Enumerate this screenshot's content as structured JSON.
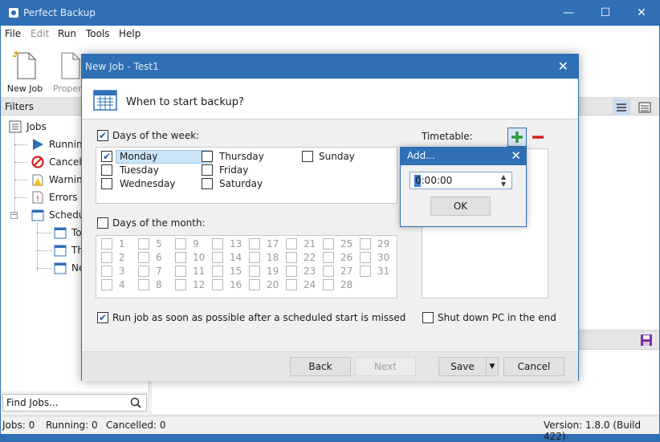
{
  "app": {
    "title": "Perfect Backup"
  },
  "window_controls": {
    "minimize": "—",
    "maximize": "☐",
    "close": "✕"
  },
  "menu": [
    "File",
    "Edit",
    "Run",
    "Tools",
    "Help"
  ],
  "toolbar": {
    "new_job": "New Job",
    "properties": "Propert"
  },
  "filters": {
    "header": "Filters",
    "tree": {
      "jobs": "Jobs",
      "running": "Running",
      "cancelled": "Cancelle",
      "warnings": "Warning",
      "errors": "Errors",
      "scheduled": "Schedul",
      "sub1": "To",
      "sub2": "Th",
      "sub3": "Ne"
    }
  },
  "find_jobs": {
    "placeholder": "Find Jobs..."
  },
  "status": {
    "jobs": "Jobs: 0",
    "running": "Running: 0",
    "cancelled": "Cancelled: 0",
    "version": "Version: 1.8.0 (Build 422)"
  },
  "dialog": {
    "title": "New Job - Test1",
    "heading": "When to start backup?",
    "days_of_week": {
      "label": "Days of the week:",
      "checked": true,
      "days": [
        {
          "name": "Monday",
          "checked": true,
          "selected": true
        },
        {
          "name": "Tuesday",
          "checked": false
        },
        {
          "name": "Wednesday",
          "checked": false
        },
        {
          "name": "Thursday",
          "checked": false
        },
        {
          "name": "Friday",
          "checked": false
        },
        {
          "name": "Saturday",
          "checked": false
        },
        {
          "name": "Sunday",
          "checked": false
        }
      ]
    },
    "days_of_month": {
      "label": "Days of the month:",
      "checked": false,
      "days": [
        "1",
        "2",
        "3",
        "4",
        "5",
        "6",
        "7",
        "8",
        "9",
        "10",
        "11",
        "12",
        "13",
        "14",
        "15",
        "16",
        "17",
        "18",
        "19",
        "20",
        "21",
        "22",
        "23",
        "24",
        "25",
        "26",
        "27",
        "28",
        "29",
        "30",
        "31"
      ]
    },
    "timetable": {
      "label": "Timetable:"
    },
    "run_missed": {
      "label": "Run job as soon as possible after a scheduled start is missed",
      "checked": true
    },
    "shutdown": {
      "label": "Shut down PC in the end",
      "checked": false
    },
    "buttons": {
      "back": "Back",
      "next": "Next",
      "save": "Save",
      "cancel": "Cancel"
    }
  },
  "add_popup": {
    "title": "Add...",
    "time_value": "0:00:00",
    "ok": "OK"
  },
  "colors": {
    "accent": "#2f6fb5",
    "selection": "#cce4f7"
  }
}
